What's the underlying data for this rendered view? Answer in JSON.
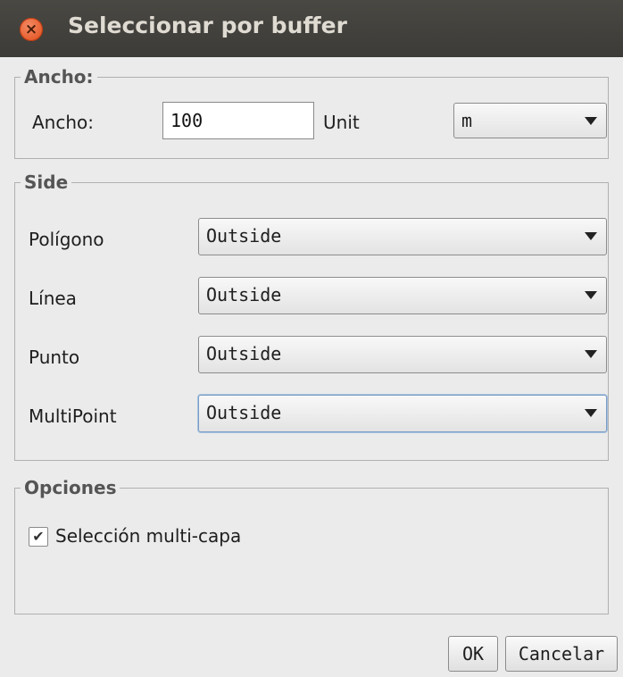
{
  "window": {
    "title": "Seleccionar por buffer",
    "close_glyph": "×"
  },
  "width_group": {
    "legend": "Ancho:",
    "label": "Ancho:",
    "value": "100",
    "unit_label": "Unit",
    "unit_value": "m"
  },
  "side_group": {
    "legend": "Side",
    "rows": [
      {
        "label": "Polígono",
        "value": "Outside"
      },
      {
        "label": "Línea",
        "value": "Outside"
      },
      {
        "label": "Punto",
        "value": "Outside"
      },
      {
        "label": "MultiPoint",
        "value": "Outside"
      }
    ]
  },
  "options_group": {
    "legend": "Opciones",
    "multilayer_label": "Selección multi-capa",
    "multilayer_checked": true,
    "check_glyph": "✔"
  },
  "buttons": {
    "ok": "OK",
    "cancel": "Cancelar"
  },
  "icons": {
    "close": "close-icon",
    "dropdown": "chevron-down-icon",
    "check": "checkmark-icon"
  },
  "colors": {
    "titlebar": "#3c3b37",
    "close": "#df4a16",
    "background": "#ebebeb"
  }
}
